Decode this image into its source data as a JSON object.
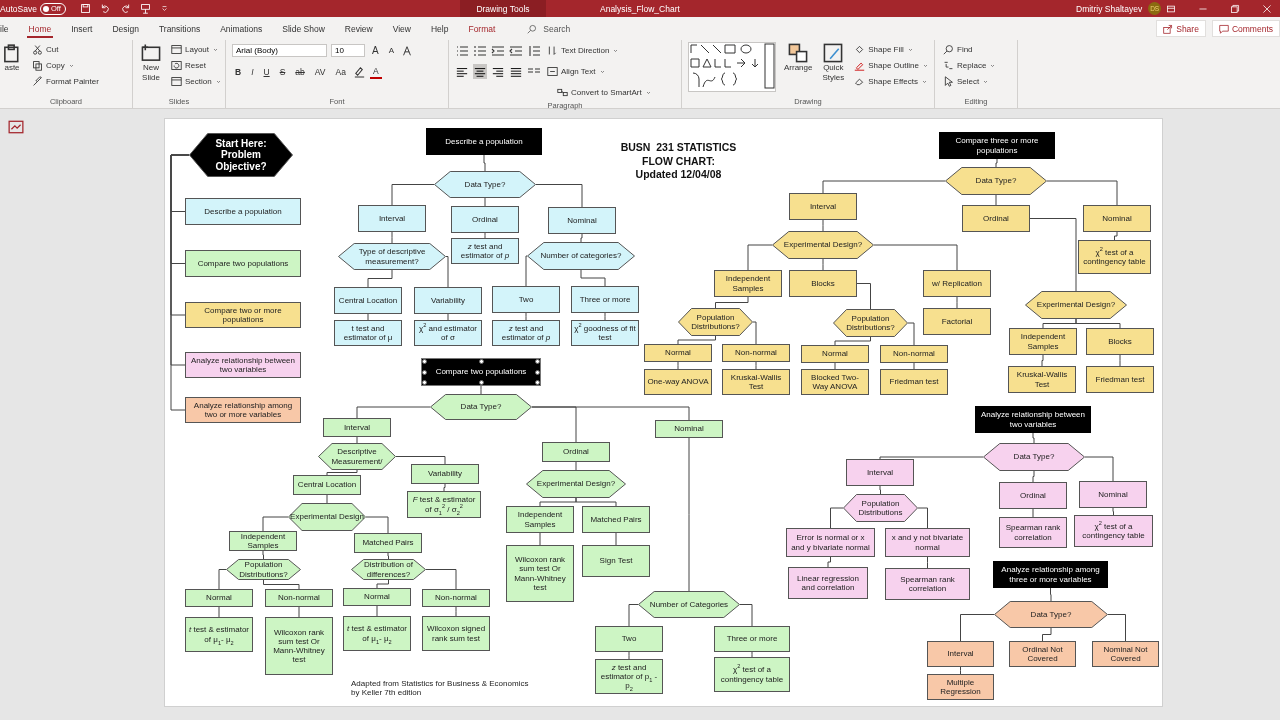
{
  "title_bar": {
    "autosave": {
      "label": "AutoSave",
      "state_text": "Off",
      "on": false
    },
    "context_tab": "Drawing Tools",
    "title": "Analysis_Flow_Chart",
    "user": "Dmitriy Shaltayev",
    "avatar": "DS"
  },
  "tabs": [
    {
      "label": "ile",
      "kind": "normal",
      "selected": false
    },
    {
      "label": "Home",
      "kind": "normal",
      "selected": true
    },
    {
      "label": "Insert",
      "kind": "normal",
      "selected": false
    },
    {
      "label": "Design",
      "kind": "normal",
      "selected": false
    },
    {
      "label": "Transitions",
      "kind": "normal",
      "selected": false
    },
    {
      "label": "Animations",
      "kind": "normal",
      "selected": false
    },
    {
      "label": "Slide Show",
      "kind": "normal",
      "selected": false
    },
    {
      "label": "Review",
      "kind": "normal",
      "selected": false
    },
    {
      "label": "View",
      "kind": "normal",
      "selected": false
    },
    {
      "label": "Help",
      "kind": "normal",
      "selected": false
    },
    {
      "label": "Format",
      "kind": "contextual",
      "selected": false
    }
  ],
  "search": {
    "placeholder": "Search"
  },
  "share": "Share",
  "comments": "Comments",
  "ribbon": {
    "groups": [
      {
        "label": "Clipboard",
        "commands": [
          "aste",
          "Cut",
          "Copy",
          "Format Painter"
        ]
      },
      {
        "label": "Slides",
        "commands": [
          "New Slide",
          "Layout",
          "Reset",
          "Section"
        ]
      },
      {
        "label": "Font",
        "font": "Arial (Body)",
        "size": "10",
        "size_buttons": [
          "A",
          "A"
        ],
        "format_buttons": [
          "B",
          "I",
          "U",
          "S",
          "ab",
          "AV",
          "Aa"
        ],
        "font_color": "A"
      },
      {
        "label": "Paragraph",
        "commands": [
          "Text Direction",
          "Align Text",
          "Convert to SmartArt"
        ],
        "alignments": [
          {
            "selected": false
          },
          {
            "selected": true
          },
          {
            "selected": false
          },
          {
            "selected": false
          }
        ]
      },
      {
        "label": "Drawing",
        "commands": [
          "Arrange",
          "Quick Styles",
          "Shape Fill",
          "Shape Outline",
          "Shape Effects"
        ]
      },
      {
        "label": "Editing",
        "commands": [
          "Find",
          "Replace",
          "Select"
        ]
      }
    ]
  },
  "flowchart": {
    "title": "BUSN  231 STATISTICS\nFLOW CHART:\nUpdated 12/04/08",
    "sections": [
      {
        "nodes": [
          {
            "kind": "blackhex",
            "text": "Start Here: Problem Objective?",
            "selected": false
          },
          {
            "kind": "rect",
            "text": "Describe a population",
            "color": "#d3f4fa",
            "selected": false
          },
          {
            "kind": "rect",
            "text": "Compare two populations",
            "color": "#cdf5c4",
            "selected": false
          },
          {
            "kind": "rect",
            "text": "Compare two or more populations",
            "color": "#f7e08f",
            "selected": false
          },
          {
            "kind": "rect",
            "text": "Analyze relationship between two variables",
            "color": "#f7d2ee",
            "selected": false
          },
          {
            "kind": "rect",
            "text": "Analyze relationship among two or more variables",
            "color": "#f8c8a8",
            "selected": false
          }
        ]
      },
      {
        "color": "#d3f4fa",
        "nodes": [
          {
            "kind": "black",
            "text": "Describe a population",
            "selected": false
          },
          {
            "kind": "hex",
            "text": "Data Type?",
            "selected": false
          },
          {
            "kind": "rect",
            "text": "Interval",
            "selected": false
          },
          {
            "kind": "rect",
            "text": "Ordinal",
            "selected": false
          },
          {
            "kind": "rect",
            "text": "Nominal",
            "selected": false
          },
          {
            "kind": "hex",
            "text": "Type of  descriptive measurement?",
            "selected": false
          },
          {
            "kind": "rect",
            "text": "*z* test and estimator of *p*",
            "selected": false
          },
          {
            "kind": "hex",
            "text": "Number of categories?",
            "selected": false
          },
          {
            "kind": "rect",
            "text": "Central Location",
            "selected": false
          },
          {
            "kind": "rect",
            "text": "Variability",
            "selected": false
          },
          {
            "kind": "rect",
            "text": "Two",
            "selected": false
          },
          {
            "kind": "rect",
            "text": "Three or more",
            "selected": false
          },
          {
            "kind": "rect",
            "text": "t test and estimator of μ",
            "selected": false
          },
          {
            "kind": "rect",
            "text": "χ$^{2}$ and estimator of σ",
            "selected": false
          },
          {
            "kind": "rect",
            "text": "*z* test and estimator of *p*",
            "selected": false
          },
          {
            "kind": "rect",
            "text": "χ$^{2}$  goodness of fit test",
            "selected": false
          }
        ]
      },
      {
        "color": "#cdf5c4",
        "nodes": [
          {
            "kind": "black",
            "text": "Compare two populations",
            "selected": true
          },
          {
            "kind": "hex",
            "text": "Data Type?",
            "selected": false
          },
          {
            "kind": "rect",
            "text": "Interval",
            "selected": false
          },
          {
            "kind": "hex",
            "text": "Descriptive Measurement/",
            "selected": false
          },
          {
            "kind": "rect",
            "text": "Variability",
            "selected": false
          },
          {
            "kind": "rect",
            "text": "Central Location",
            "selected": false
          },
          {
            "kind": "hex",
            "text": "Experimental Design",
            "selected": false
          },
          {
            "kind": "rect",
            "text": "*F* test & estimator of σ$_{1}$$^{2}$ / σ$_{2}$$^{2}$",
            "selected": false
          },
          {
            "kind": "rect",
            "text": "Independent Samples",
            "selected": false
          },
          {
            "kind": "rect",
            "text": "Matched Pairs",
            "selected": false
          },
          {
            "kind": "hex",
            "text": "Population Distributions?",
            "selected": false
          },
          {
            "kind": "hex",
            "text": "Distribution of differences?",
            "selected": false
          },
          {
            "kind": "rect",
            "text": "Normal",
            "selected": false
          },
          {
            "kind": "rect",
            "text": "Non-normal",
            "selected": false
          },
          {
            "kind": "rect",
            "text": "Normal",
            "selected": false
          },
          {
            "kind": "rect",
            "text": "Non-normal",
            "selected": false
          },
          {
            "kind": "rect",
            "text": "*t* test & estimator of μ$_{1}$- μ$_{2}$",
            "selected": false
          },
          {
            "kind": "rect",
            "text": "Wilcoxon rank sum test Or Mann-Whitney test",
            "selected": false
          },
          {
            "kind": "rect",
            "text": "*t* test & estimator of μ$_{1}$- μ$_{2}$",
            "selected": false
          },
          {
            "kind": "rect",
            "text": "Wilcoxon signed  rank sum test",
            "selected": false
          },
          {
            "kind": "rect",
            "text": "Ordinal",
            "selected": false
          },
          {
            "kind": "hex",
            "text": "Experimental Design?",
            "selected": false
          },
          {
            "kind": "rect",
            "text": "Independent Samples",
            "selected": false
          },
          {
            "kind": "rect",
            "text": "Matched Pairs",
            "selected": false
          },
          {
            "kind": "rect",
            "text": "Wilcoxon rank sum test Or Mann-Whitney test",
            "selected": false
          },
          {
            "kind": "rect",
            "text": "Sign Test",
            "selected": false
          },
          {
            "kind": "rect",
            "text": "Nominal",
            "selected": false
          },
          {
            "kind": "hex",
            "text": "Number of Categories",
            "selected": false
          },
          {
            "kind": "rect",
            "text": "Two",
            "selected": false
          },
          {
            "kind": "rect",
            "text": "Three or more",
            "selected": false
          },
          {
            "kind": "rect",
            "text": "*z* test and estimator of p$_{1}$ - p$_{2}$",
            "selected": false
          },
          {
            "kind": "rect",
            "text": "χ$^{2}$ test of a contingency table",
            "selected": false
          }
        ]
      },
      {
        "color": "#f7e08f",
        "nodes": [
          {
            "kind": "black",
            "text": "Compare three or more populations",
            "selected": false
          },
          {
            "kind": "hex",
            "text": "Data Type?",
            "selected": false
          },
          {
            "kind": "rect",
            "text": "Interval",
            "selected": false
          },
          {
            "kind": "rect",
            "text": "Ordinal",
            "selected": false
          },
          {
            "kind": "rect",
            "text": "Nominal",
            "selected": false
          },
          {
            "kind": "hex",
            "text": "Experimental Design?",
            "selected": false
          },
          {
            "kind": "rect",
            "text": "χ$^{2}$ test of a contingency table",
            "selected": false
          },
          {
            "kind": "rect",
            "text": "Independent Samples",
            "selected": false
          },
          {
            "kind": "rect",
            "text": "Blocks",
            "selected": false
          },
          {
            "kind": "rect",
            "text": "w/ Replication",
            "selected": false
          },
          {
            "kind": "hex",
            "text": "Population Distributions?",
            "selected": false
          },
          {
            "kind": "hex",
            "text": "Population Distributions?",
            "selected": false
          },
          {
            "kind": "rect",
            "text": "Factorial",
            "selected": false
          },
          {
            "kind": "hex",
            "text": "Experimental Design?",
            "selected": false
          },
          {
            "kind": "rect",
            "text": "Normal",
            "selected": false
          },
          {
            "kind": "rect",
            "text": "Non-normal",
            "selected": false
          },
          {
            "kind": "rect",
            "text": "Normal",
            "selected": false
          },
          {
            "kind": "rect",
            "text": "Non-normal",
            "selected": false
          },
          {
            "kind": "rect",
            "text": "One-way ANOVA",
            "selected": false
          },
          {
            "kind": "rect",
            "text": "Kruskal-Wallis Test",
            "selected": false
          },
          {
            "kind": "rect",
            "text": "Blocked Two-Way ANOVA",
            "selected": false
          },
          {
            "kind": "rect",
            "text": "Friedman test",
            "selected": false
          },
          {
            "kind": "rect",
            "text": "Independent Samples",
            "selected": false
          },
          {
            "kind": "rect",
            "text": "Blocks",
            "selected": false
          },
          {
            "kind": "rect",
            "text": "Kruskal-Wallis Test",
            "selected": false
          },
          {
            "kind": "rect",
            "text": "Friedman test",
            "selected": false
          }
        ]
      },
      {
        "color": "#f7d2ee",
        "nodes": [
          {
            "kind": "black",
            "text": "Analyze relationship between two variables",
            "selected": false
          },
          {
            "kind": "hex",
            "text": "Data Type?",
            "selected": false
          },
          {
            "kind": "rect",
            "text": "Interval",
            "selected": false
          },
          {
            "kind": "rect",
            "text": "Ordinal",
            "selected": false
          },
          {
            "kind": "rect",
            "text": "Nominal",
            "selected": false
          },
          {
            "kind": "hex",
            "text": "Population Distributions",
            "selected": false
          },
          {
            "kind": "rect",
            "text": "Error is normal or x and y bivariate normal",
            "selected": false
          },
          {
            "kind": "rect",
            "text": "x and y not bivariate normal",
            "selected": false
          },
          {
            "kind": "rect",
            "text": "Spearman rank correlation",
            "selected": false
          },
          {
            "kind": "rect",
            "text": "χ$^{2}$ test of a contingency table",
            "selected": false
          },
          {
            "kind": "rect",
            "text": "Linear regression and correlation",
            "selected": false
          },
          {
            "kind": "rect",
            "text": "Spearman rank correlation",
            "selected": false
          }
        ]
      },
      {
        "color": "#f8c8a8",
        "nodes": [
          {
            "kind": "black",
            "text": "Analyze relationship among three or more variables",
            "selected": false
          },
          {
            "kind": "hex",
            "text": "Data Type?",
            "selected": false
          },
          {
            "kind": "rect",
            "text": "Interval",
            "selected": false
          },
          {
            "kind": "rect",
            "text": "Ordinal Not Covered",
            "selected": false
          },
          {
            "kind": "rect",
            "text": "Nominal Not Covered",
            "selected": false
          },
          {
            "kind": "rect",
            "text": "Multiple Regression",
            "selected": false
          }
        ]
      }
    ],
    "credit": "Adapted from Statistics for Business & Economics\nby Keller 7th edition"
  }
}
